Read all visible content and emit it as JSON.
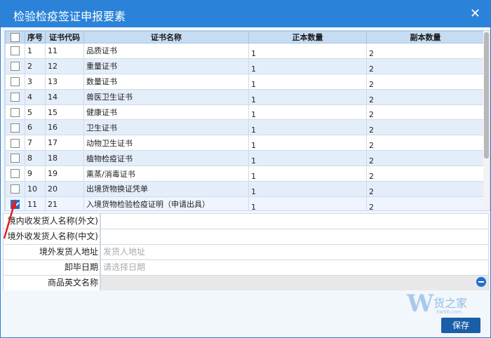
{
  "dialog": {
    "title": "检验检疫签证申报要素",
    "close_glyph": "✕"
  },
  "grid": {
    "columns": [
      "序号",
      "证书代码",
      "证书名称",
      "正本数量",
      "副本数量"
    ],
    "rows": [
      {
        "no": "1",
        "code": "11",
        "name": "品质证书",
        "orig": "1",
        "copy": "2",
        "checked": false
      },
      {
        "no": "2",
        "code": "12",
        "name": "重量证书",
        "orig": "1",
        "copy": "2",
        "checked": false
      },
      {
        "no": "3",
        "code": "13",
        "name": "数量证书",
        "orig": "1",
        "copy": "2",
        "checked": false
      },
      {
        "no": "4",
        "code": "14",
        "name": "兽医卫生证书",
        "orig": "1",
        "copy": "2",
        "checked": false
      },
      {
        "no": "5",
        "code": "15",
        "name": "健康证书",
        "orig": "1",
        "copy": "2",
        "checked": false
      },
      {
        "no": "6",
        "code": "16",
        "name": "卫生证书",
        "orig": "1",
        "copy": "2",
        "checked": false
      },
      {
        "no": "7",
        "code": "17",
        "name": "动物卫生证书",
        "orig": "1",
        "copy": "2",
        "checked": false
      },
      {
        "no": "8",
        "code": "18",
        "name": "植物检疫证书",
        "orig": "1",
        "copy": "2",
        "checked": false
      },
      {
        "no": "9",
        "code": "19",
        "name": "熏蒸/消毒证书",
        "orig": "1",
        "copy": "2",
        "checked": false
      },
      {
        "no": "10",
        "code": "20",
        "name": "出境货物换证凭单",
        "orig": "1",
        "copy": "2",
        "checked": false
      },
      {
        "no": "11",
        "code": "21",
        "name": "入境货物检验检疫证明（申请出具）",
        "orig": "1",
        "copy": "2",
        "checked": true
      }
    ]
  },
  "form": {
    "fields": [
      {
        "label": "境内收发货人名称(外文)",
        "value": "",
        "placeholder": ""
      },
      {
        "label": "境外收发货人名称(中文)",
        "value": "",
        "placeholder": ""
      },
      {
        "label": "境外发货人地址",
        "value": "",
        "placeholder": "发货人地址"
      },
      {
        "label": "卸毕日期",
        "value": "",
        "placeholder": "请选择日期"
      },
      {
        "label": "商品英文名称",
        "value": "",
        "placeholder": ""
      }
    ]
  },
  "save_label": "保存",
  "watermark": {
    "logo": "W",
    "name": "货之家",
    "url": "5w56.com"
  },
  "colors": {
    "titlebar": "#2a83d8",
    "header": "#c5dcf3",
    "accent": "#1e6fd6",
    "arrow": "#e02020"
  }
}
